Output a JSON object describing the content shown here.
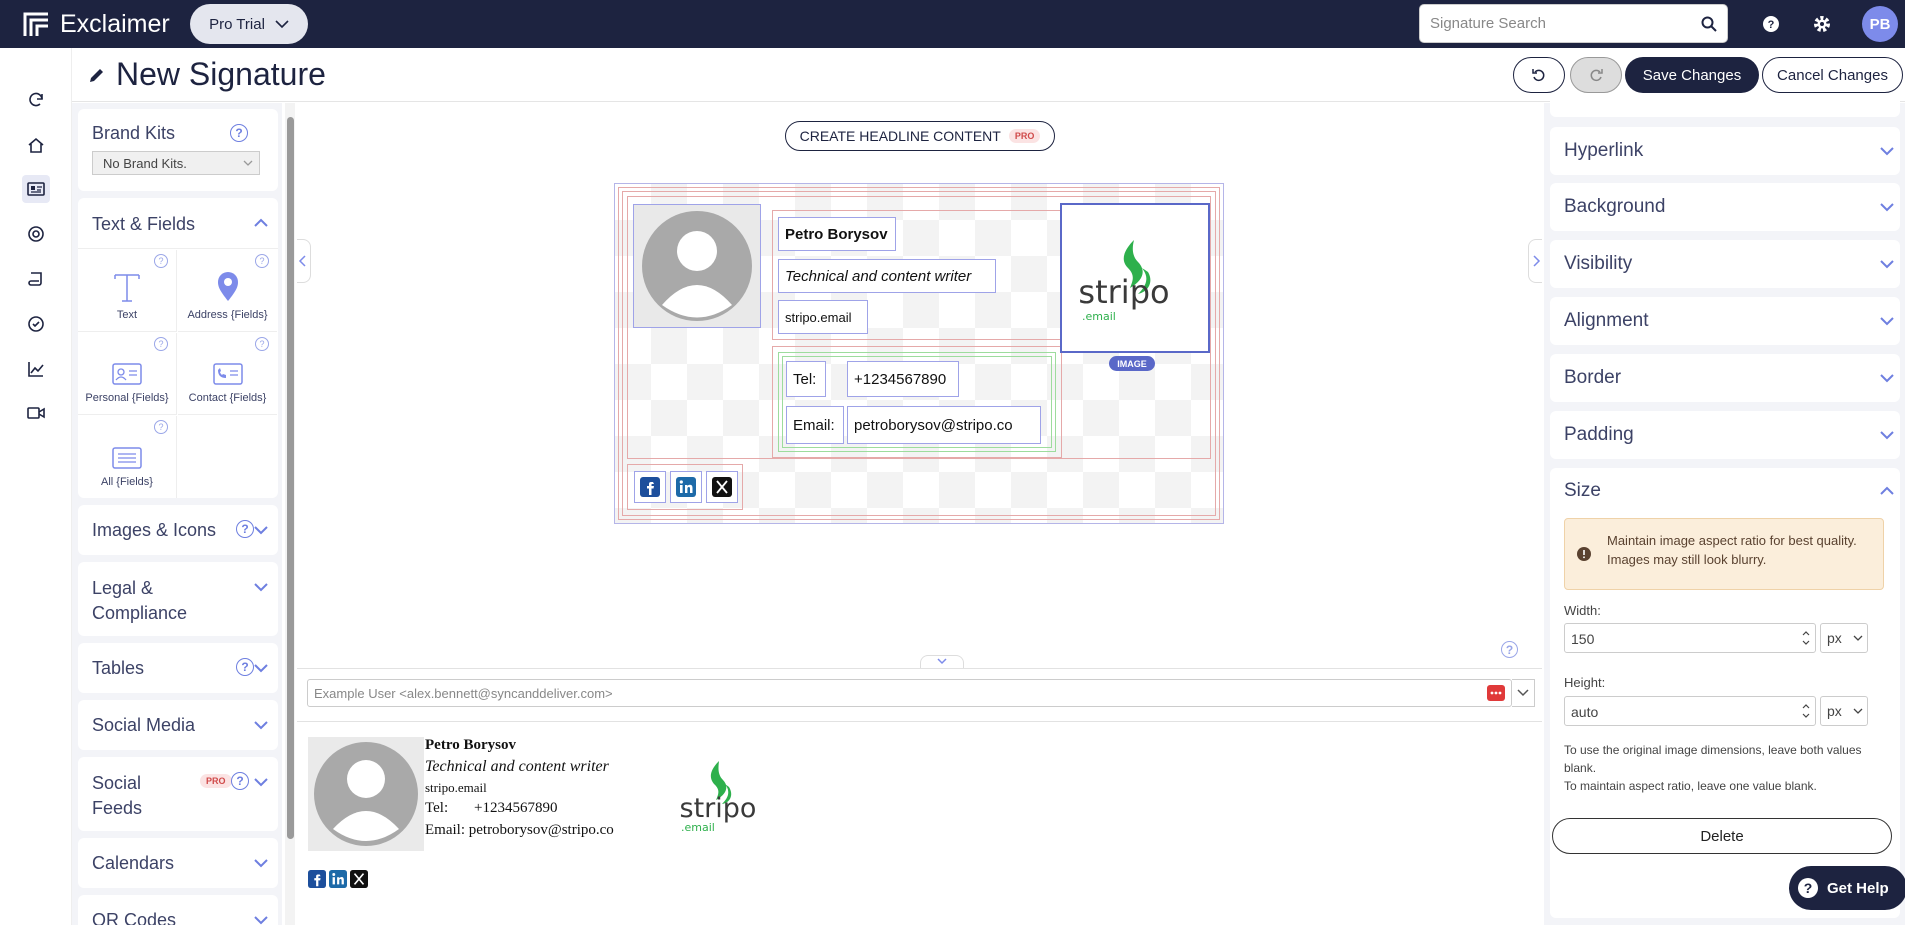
{
  "app": {
    "name": "Exclaimer",
    "plan": "Pro Trial"
  },
  "topbar": {
    "search_placeholder": "Signature Search",
    "avatar": "PB"
  },
  "rail": {
    "items": [
      "refresh-icon",
      "home-icon",
      "signatures-icon",
      "target-icon",
      "scroll-icon",
      "check-circle-icon",
      "analytics-icon",
      "video-icon"
    ]
  },
  "header": {
    "title": "New Signature",
    "save": "Save Changes",
    "cancel": "Cancel Changes"
  },
  "left": {
    "brand_kits": {
      "title": "Brand Kits",
      "select": "No Brand Kits."
    },
    "text_fields": {
      "title": "Text & Fields",
      "tiles": [
        "Text",
        "Address {Fields}",
        "Personal {Fields}",
        "Contact {Fields}",
        "All {Fields}"
      ]
    },
    "sections": [
      "Images & Icons",
      "Legal & Compliance",
      "Tables",
      "Social Media",
      "Social Feeds",
      "Calendars",
      "QR Codes"
    ],
    "pro": "PRO"
  },
  "canvas": {
    "headline_button": "CREATE HEADLINE CONTENT",
    "pro": "PRO",
    "name": "Petro Borysov",
    "job": "Technical and content writer",
    "company": "stripo.email",
    "tel_label": "Tel:",
    "tel": "+1234567890",
    "email_label": "Email:",
    "email": "petroborysov@stripo.co",
    "image_badge": "IMAGE",
    "logo_text": "stripo",
    "logo_sub": ".email"
  },
  "preview": {
    "sender": "Example User <alex.bennett@syncanddeliver.com>",
    "name": "Petro Borysov",
    "job": "Technical and content writer",
    "company": "stripo.email",
    "tel_label": "Tel:",
    "tel": "+1234567890",
    "email_line": "Email: petroborysov@stripo.co",
    "logo_text": "stripo",
    "logo_sub": ".email"
  },
  "right": {
    "sections": [
      "Hyperlink",
      "Background",
      "Visibility",
      "Alignment",
      "Border",
      "Padding",
      "Size"
    ],
    "notice": "Maintain image aspect ratio for best quality. Images may still look blurry.",
    "width_label": "Width:",
    "width_value": "150",
    "height_label": "Height:",
    "height_value": "auto",
    "unit": "px",
    "hint1": "To use the original image dimensions, leave both values blank.",
    "hint2": "To maintain aspect ratio, leave one value blank.",
    "delete": "Delete",
    "help": "Get Help"
  },
  "colors": {
    "navy": "#1d2340",
    "accent": "#6e7fe0",
    "notice_bg": "#fbeedb",
    "logo_green": "#2eb04c"
  }
}
